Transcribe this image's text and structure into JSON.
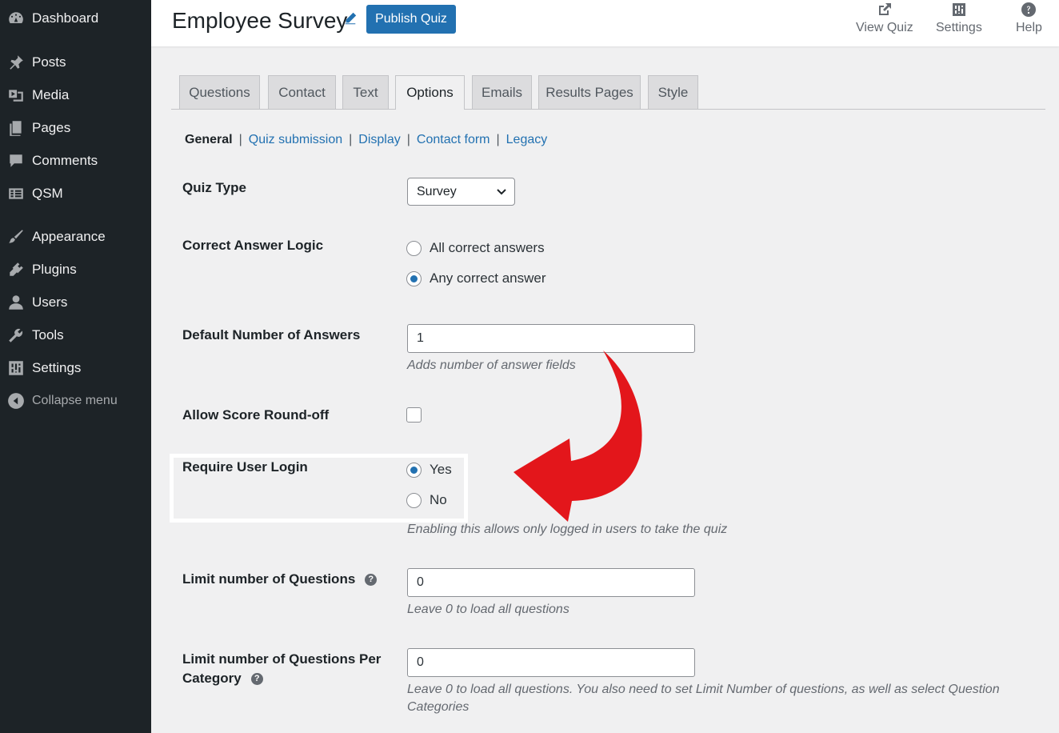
{
  "sidebar": {
    "items": [
      {
        "label": "Dashboard",
        "icon": "dashboard-icon"
      },
      {
        "label": "Posts",
        "icon": "pin-icon"
      },
      {
        "label": "Media",
        "icon": "media-icon"
      },
      {
        "label": "Pages",
        "icon": "pages-icon"
      },
      {
        "label": "Comments",
        "icon": "comment-icon"
      },
      {
        "label": "QSM",
        "icon": "list-icon"
      },
      {
        "label": "Appearance",
        "icon": "brush-icon"
      },
      {
        "label": "Plugins",
        "icon": "plug-icon"
      },
      {
        "label": "Users",
        "icon": "user-icon"
      },
      {
        "label": "Tools",
        "icon": "wrench-icon"
      },
      {
        "label": "Settings",
        "icon": "sliders-icon"
      }
    ],
    "collapse_label": "Collapse menu"
  },
  "header": {
    "title": "Employee Survey",
    "publish_label": "Publish Quiz",
    "actions": {
      "view_quiz": "View Quiz",
      "settings": "Settings",
      "help": "Help"
    }
  },
  "tabs": [
    "Questions",
    "Contact",
    "Text",
    "Options",
    "Emails",
    "Results Pages",
    "Style"
  ],
  "active_tab": "Options",
  "subnav": {
    "current": "General",
    "links": [
      "Quiz submission",
      "Display",
      "Contact form",
      "Legacy"
    ],
    "separator": "|"
  },
  "form": {
    "quiz_type": {
      "label": "Quiz Type",
      "value": "Survey"
    },
    "correct_answer_logic": {
      "label": "Correct Answer Logic",
      "options": [
        "All correct answers",
        "Any correct answer"
      ],
      "selected": "Any correct answer"
    },
    "default_answers": {
      "label": "Default Number of Answers",
      "value": "1",
      "hint": "Adds number of answer fields"
    },
    "score_roundoff": {
      "label": "Allow Score Round-off",
      "checked": false
    },
    "require_login": {
      "label": "Require User Login",
      "options": [
        "Yes",
        "No"
      ],
      "selected": "Yes",
      "hint": "Enabling this allows only logged in users to take the quiz"
    },
    "limit_questions": {
      "label": "Limit number of Questions",
      "value": "0",
      "hint": "Leave 0 to load all questions"
    },
    "limit_per_category": {
      "label_line1": "Limit number of Questions Per",
      "label_line2": "Category",
      "value": "0",
      "hint_line1": "Leave 0 to load all questions. You also need to set Limit Number of questions, as well as select Question",
      "hint_line2": "Categories"
    }
  },
  "colors": {
    "sidebar_bg": "#1d2327",
    "accent": "#2271b1",
    "annotation_arrow": "#e3161b"
  }
}
